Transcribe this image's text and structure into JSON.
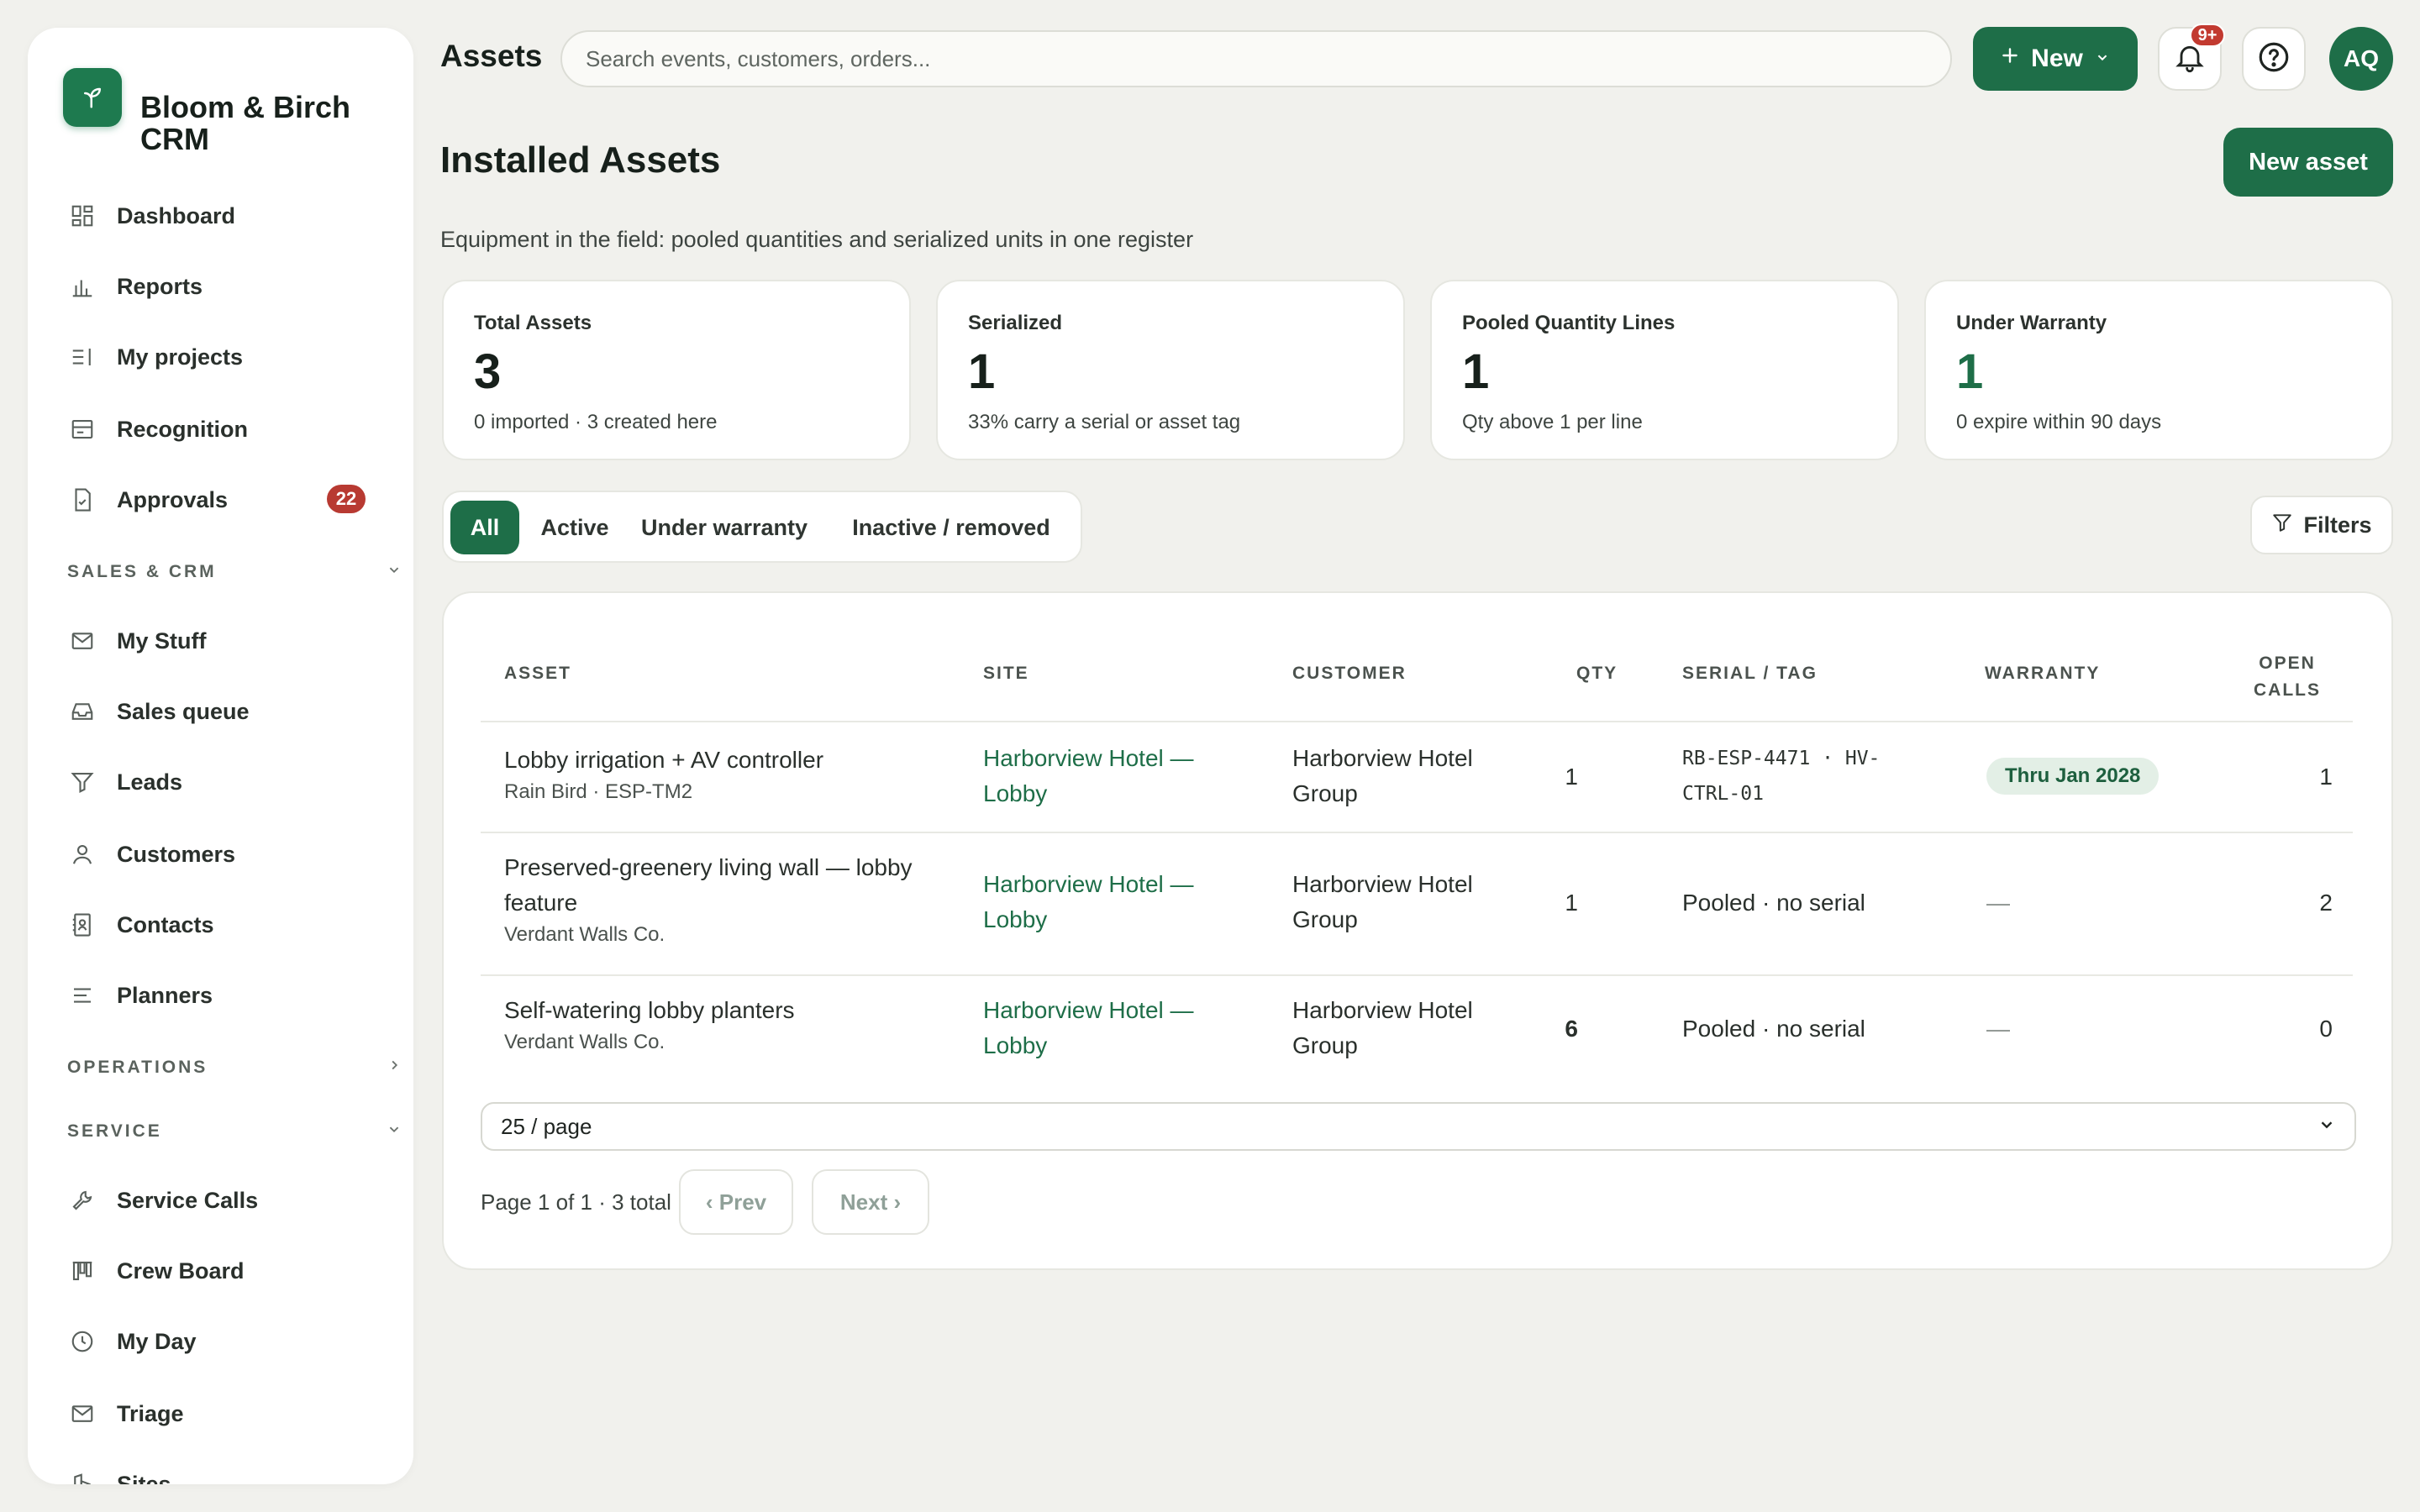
{
  "brand": {
    "name": "Bloom & Birch CRM",
    "icon": "sprout-icon"
  },
  "sidebar": {
    "items": [
      {
        "id": "dashboard",
        "label": "Dashboard",
        "icon": "grid-icon"
      },
      {
        "id": "reports",
        "label": "Reports",
        "icon": "bar-chart-icon"
      },
      {
        "id": "my-projects",
        "label": "My projects",
        "icon": "list-icon"
      },
      {
        "id": "recognition",
        "label": "Recognition",
        "icon": "card-icon"
      },
      {
        "id": "approvals",
        "label": "Approvals",
        "icon": "document-check-icon",
        "badge": "22"
      }
    ],
    "sections": [
      {
        "id": "sales-crm",
        "label": "SALES & CRM",
        "expanded": true,
        "items": [
          {
            "id": "my-stuff",
            "label": "My Stuff",
            "icon": "mail-icon"
          },
          {
            "id": "sales-queue",
            "label": "Sales queue",
            "icon": "inbox-icon"
          },
          {
            "id": "leads",
            "label": "Leads",
            "icon": "funnel-icon"
          },
          {
            "id": "customers",
            "label": "Customers",
            "icon": "user-icon"
          },
          {
            "id": "contacts",
            "label": "Contacts",
            "icon": "address-book-icon"
          },
          {
            "id": "planners",
            "label": "Planners",
            "icon": "lines-icon"
          }
        ]
      },
      {
        "id": "operations",
        "label": "OPERATIONS",
        "expanded": false,
        "items": []
      },
      {
        "id": "service",
        "label": "SERVICE",
        "expanded": true,
        "items": [
          {
            "id": "service-calls",
            "label": "Service Calls",
            "icon": "wrench-icon"
          },
          {
            "id": "crew-board",
            "label": "Crew Board",
            "icon": "board-icon"
          },
          {
            "id": "my-day",
            "label": "My Day",
            "icon": "clock-icon"
          },
          {
            "id": "triage",
            "label": "Triage",
            "icon": "mail-icon"
          },
          {
            "id": "sites",
            "label": "Sites",
            "icon": "building-icon"
          }
        ]
      }
    ]
  },
  "topbar": {
    "title": "Assets",
    "search_placeholder": "Search events, customers, orders...",
    "new_label": "New",
    "notifications_badge": "9+",
    "avatar_initials": "AQ"
  },
  "header": {
    "title": "Installed Assets",
    "new_asset_label": "New asset",
    "subtitle": "Equipment in the field: pooled quantities and serialized units in one register"
  },
  "stats": [
    {
      "label": "Total Assets",
      "value": "3",
      "note": "0 imported · 3 created here",
      "green": false
    },
    {
      "label": "Serialized",
      "value": "1",
      "note": "33% carry a serial or asset tag",
      "green": false
    },
    {
      "label": "Pooled Quantity Lines",
      "value": "1",
      "note": "Qty above 1 per line",
      "green": false
    },
    {
      "label": "Under Warranty",
      "value": "1",
      "note": "0 expire within 90 days",
      "green": true
    }
  ],
  "tabs": [
    {
      "label": "All",
      "active": true
    },
    {
      "label": "Active",
      "active": false
    },
    {
      "label": "Under warranty",
      "active": false
    },
    {
      "label": "Inactive / removed",
      "active": false
    }
  ],
  "filters_label": "Filters",
  "table": {
    "columns": [
      "ASSET",
      "SITE",
      "CUSTOMER",
      "QTY",
      "SERIAL / TAG",
      "WARRANTY",
      "OPEN CALLS"
    ],
    "rows": [
      {
        "asset": "Lobby irrigation + AV controller",
        "asset_sub": "Rain Bird · ESP-TM2",
        "site": "Harborview Hotel — Lobby",
        "customer": "Harborview Hotel Group",
        "qty": "1",
        "serial": "RB-ESP-4471 · HV-CTRL-01",
        "serial_mono": true,
        "warranty": "Thru Jan 2028",
        "open_calls": "1"
      },
      {
        "asset": "Preserved-greenery living wall — lobby feature",
        "asset_sub": "Verdant Walls Co.",
        "site": "Harborview Hotel — Lobby",
        "customer": "Harborview Hotel Group",
        "qty": "1",
        "serial": "Pooled · no serial",
        "serial_mono": false,
        "warranty": "—",
        "open_calls": "2"
      },
      {
        "asset": "Self-watering lobby planters",
        "asset_sub": "Verdant Walls Co.",
        "site": "Harborview Hotel — Lobby",
        "customer": "Harborview Hotel Group",
        "qty": "6",
        "serial": "Pooled · no serial",
        "serial_mono": false,
        "warranty": "—",
        "open_calls": "0"
      }
    ]
  },
  "pagination": {
    "page_size": "25 / page",
    "info": "Page 1 of 1 · 3 total",
    "prev_label": "‹ Prev",
    "next_label": "Next ›"
  }
}
